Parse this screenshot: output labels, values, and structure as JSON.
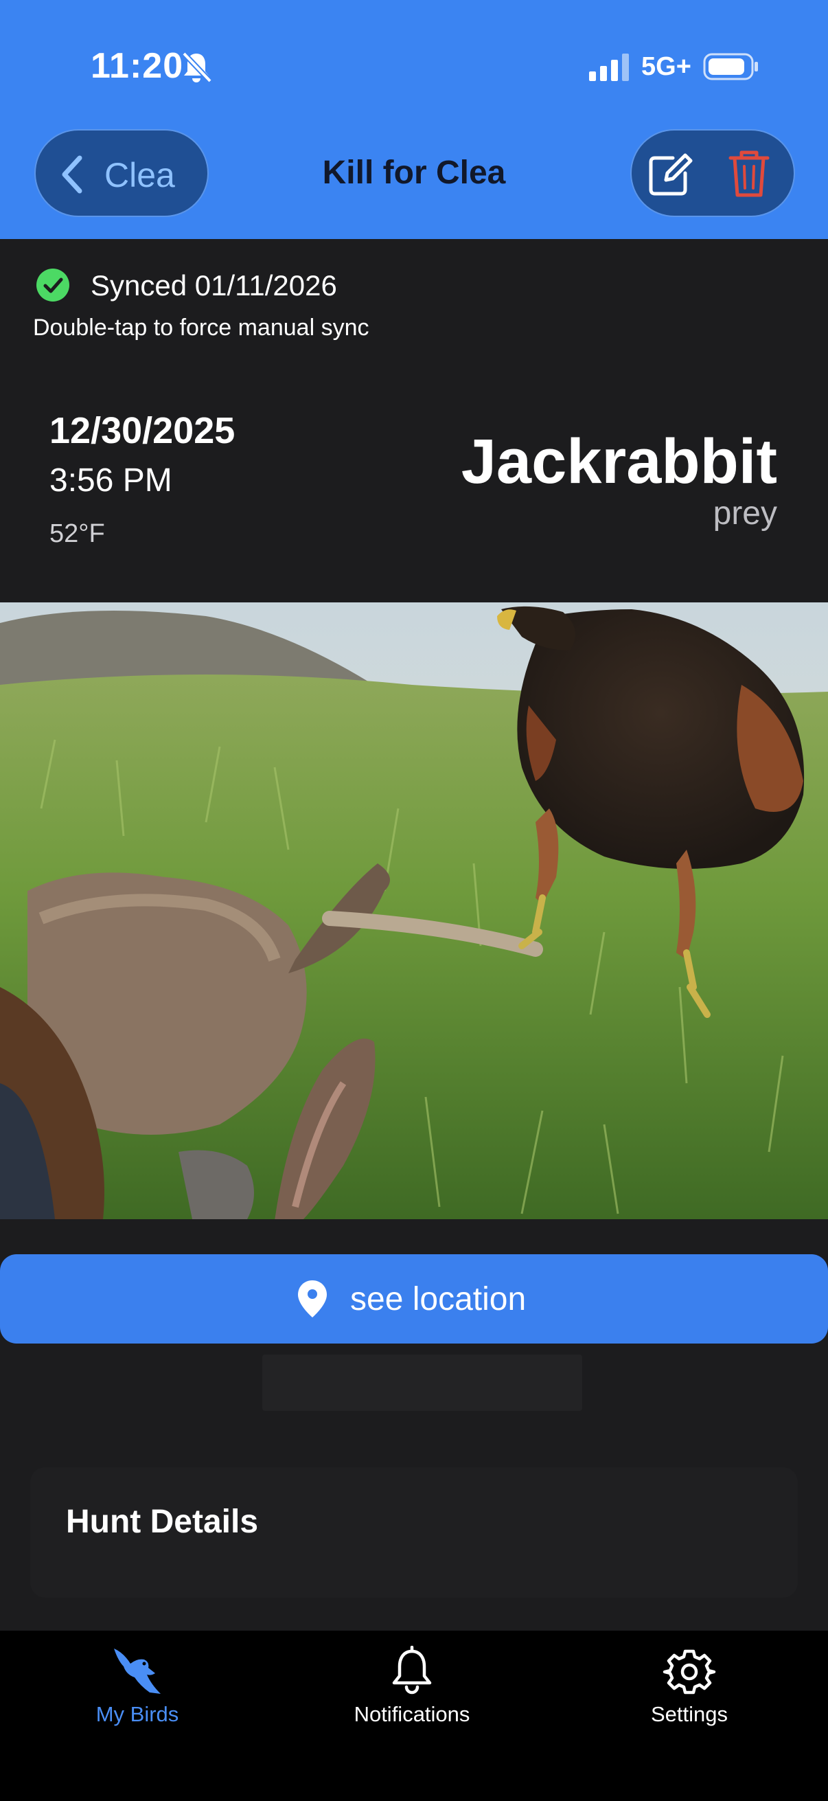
{
  "status_bar": {
    "time": "11:20",
    "network": "5G+"
  },
  "nav": {
    "back_label": "Clea",
    "title": "Kill for Clea"
  },
  "sync": {
    "status_text": "Synced 01/11/2026",
    "hint": "Double-tap to force manual sync"
  },
  "kill": {
    "date": "12/30/2025",
    "time": "3:56 PM",
    "temperature": "52°F",
    "prey_name": "Jackrabbit",
    "prey_label": "prey"
  },
  "location_button": {
    "label": "see location"
  },
  "hunt_details": {
    "title": "Hunt Details"
  },
  "tabs": [
    {
      "label": "My Birds",
      "icon": "hawk-icon",
      "active": true
    },
    {
      "label": "Notifications",
      "icon": "bell-icon",
      "active": false
    },
    {
      "label": "Settings",
      "icon": "gear-icon",
      "active": false
    }
  ],
  "colors": {
    "header": "#3b84f2",
    "accent": "#4a8ef5",
    "trash": "#e04a3c",
    "sync_ok": "#4cd964",
    "background": "#1c1c1e"
  }
}
